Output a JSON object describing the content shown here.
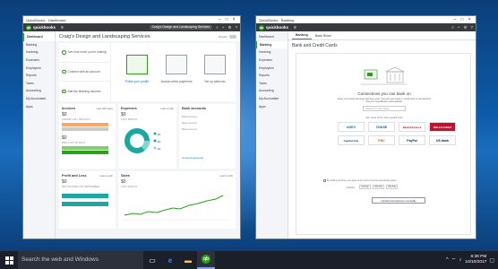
{
  "taskbar": {
    "search_placeholder": "Search the web and Windows",
    "clock_time": "6:38 PM",
    "clock_date": "10/10/2017",
    "apps": [
      "task-view",
      "edge",
      "file-explorer",
      "quickbooks"
    ]
  },
  "left_window": {
    "title_text": "QuickBooks - Dashboard",
    "brand": "quickbooks",
    "company_pill": "Craig's Design and Landscaping Services",
    "sidebar": [
      "Dashboard",
      "Banking",
      "Invoicing",
      "Expenses",
      "Employees",
      "Reports",
      "Taxes",
      "Accounting",
      "My Accountant",
      "Apps"
    ],
    "active_sidebar": "Dashboard",
    "header": {
      "title": "Craig's Design and Landscaping Services",
      "privacy_label": "Privacy"
    },
    "setup": {
      "tasks": [
        "See how much you're making",
        "Connect with an account",
        "Add the finishing touches"
      ],
      "cards": [
        "Polish your profile",
        "Accept online payments",
        "Set up sales tax"
      ]
    },
    "invoices": {
      "title": "Invoices",
      "period": "Last 365 days",
      "unpaid_value": "$0",
      "unpaid_label": "UNPAID LAST 365 DAYS",
      "paid_value": "$0",
      "paid_label": "PAID LAST 30 DAYS"
    },
    "expenses": {
      "title": "Expenses",
      "period": "Last month",
      "value": "$0",
      "label": "LAST MONTH",
      "legend": [
        "$0",
        "$0",
        "$0"
      ]
    },
    "bank_accounts": {
      "title": "Bank accounts",
      "rows": [
        "Bank account",
        "Bank account",
        "Bank account"
      ],
      "link": "Connect accounts"
    },
    "profit_loss": {
      "title": "Profit and Loss",
      "period": "Last month",
      "value": "$0",
      "label": "NET INCOME FOR SEPTEMBER"
    },
    "sales": {
      "title": "Sales",
      "period": "Last month",
      "value": "$0",
      "label": "LAST MONTH"
    }
  },
  "right_window": {
    "title_text": "QuickBooks - Banking",
    "brand": "quickbooks",
    "sidebar": [
      "Dashboard",
      "Banking",
      "Invoicing",
      "Expenses",
      "Employees",
      "Reports",
      "Taxes",
      "Accounting",
      "My Accountant",
      "Apps"
    ],
    "active_sidebar": "Banking",
    "tabs": [
      "Banking",
      "Bank Rules"
    ],
    "active_tab": "Banking",
    "heading": "Bank and Credit Cards",
    "connect_title": "Connections you can bank on",
    "connect_desc": "Keep your books accurate with less work. Connect your bank or credit card so transactions flow into QuickBooks automatically.",
    "search_placeholder": "Search for your bank",
    "popular_label": "See some of the more popular ones",
    "banks": [
      "AMEX",
      "CHASE",
      "BankofAmerica",
      "WELLS FARGO",
      "Capital One",
      "PNC",
      "PayPal",
      "US bank"
    ],
    "agree_text": "By clicking Continue, you agree to our terms of service and privacy policy",
    "cancel_label": "Cancel",
    "secure_badges": [
      "VeriSign",
      "TRUSTe",
      "TRUSTe"
    ],
    "upload_button": "Upload transactions manually"
  },
  "colors": {
    "qb_green": "#2ca01c",
    "qb_dark": "#393a3d",
    "desktop_blue": "#0d5aa8",
    "taskbar": "#1a1f29"
  }
}
